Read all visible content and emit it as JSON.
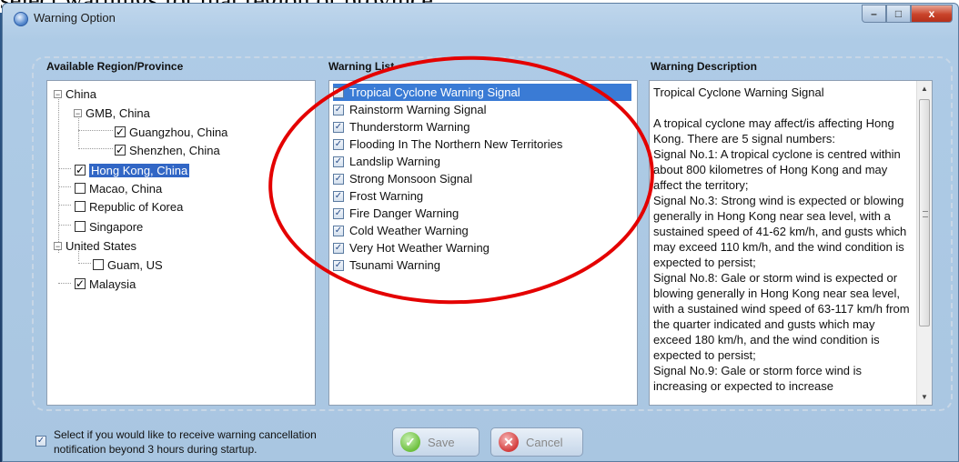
{
  "background": {
    "caption": "select warnings for that region or province."
  },
  "window": {
    "title": "Warning Option",
    "min": "–",
    "max": "□",
    "close": "x"
  },
  "columns": {
    "region": "Available Region/Province",
    "list": "Warning List",
    "desc": "Warning Description"
  },
  "tree": [
    {
      "label": "China",
      "exp": "−"
    },
    {
      "label": "GMB, China",
      "exp": "−"
    },
    {
      "label": "Guangzhou, China",
      "check": "✓"
    },
    {
      "label": "Shenzhen, China",
      "check": "✓"
    },
    {
      "label": "Hong Kong, China",
      "check": "✓"
    },
    {
      "label": "Macao, China",
      "check": ""
    },
    {
      "label": "Republic of Korea",
      "check": ""
    },
    {
      "label": "Singapore",
      "check": ""
    },
    {
      "label": "United States",
      "exp": "−"
    },
    {
      "label": "Guam, US",
      "check": ""
    },
    {
      "label": "Malaysia",
      "check": "✓"
    }
  ],
  "warnings": [
    "Tropical Cyclone Warning Signal",
    "Rainstorm Warning Signal",
    "Thunderstorm Warning",
    "Flooding In The Northern New Territories",
    "Landslip Warning",
    "Strong Monsoon Signal",
    "Frost Warning",
    "Fire Danger Warning",
    "Cold Weather Warning",
    "Very Hot Weather Warning",
    "Tsunami Warning"
  ],
  "warning_check": "✓",
  "description": [
    "Tropical Cyclone Warning Signal",
    "",
    "A tropical cyclone may affect/is affecting Hong Kong.  There are 5 signal numbers:",
    "Signal No.1: A tropical cyclone is centred within about 800 kilometres of Hong Kong and may affect the territory;",
    "Signal No.3: Strong wind is expected or blowing generally in Hong Kong near sea level, with a sustained speed of 41-62 km/h, and gusts which may exceed 110 km/h, and the wind condition is expected to persist;",
    "Signal No.8: Gale or storm wind is expected or blowing generally in Hong Kong near sea level, with a sustained wind speed of 63-117 km/h from the quarter indicated and gusts which may exceed 180 km/h, and the wind condition is expected to persist;",
    "Signal No.9: Gale or storm force wind is increasing or expected to increase"
  ],
  "scroll": {
    "up": "▲",
    "down": "▼"
  },
  "bottom": {
    "check": "✓",
    "text": "Select if you would like to receive warning cancellation notification beyond 3 hours during startup.",
    "save": "Save",
    "cancel": "Cancel",
    "save_icon": "✓",
    "cancel_icon": "✕"
  }
}
